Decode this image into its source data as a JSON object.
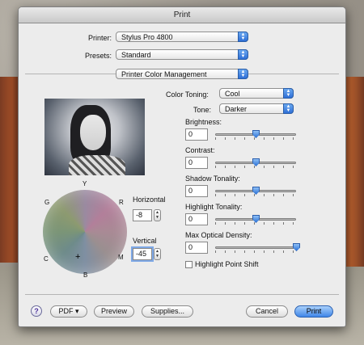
{
  "window": {
    "title": "Print"
  },
  "top": {
    "printer_label": "Printer:",
    "printer_value": "Stylus Pro 4800",
    "presets_label": "Presets:",
    "presets_value": "Standard",
    "panel_value": "Printer Color Management"
  },
  "toning": {
    "color_toning_label": "Color Toning:",
    "color_toning_value": "Cool",
    "tone_label": "Tone:",
    "tone_value": "Darker"
  },
  "wheel": {
    "letters": {
      "Y": "Y",
      "R": "R",
      "M": "M",
      "B": "B",
      "C": "C",
      "G": "G"
    },
    "crosshair": "+",
    "horizontal_label": "Horizontal",
    "horizontal_value": "-8",
    "vertical_label": "Vertical",
    "vertical_value": "-45"
  },
  "sliders": [
    {
      "label": "Brightness:",
      "value": "0",
      "level": 0.5
    },
    {
      "label": "Contrast:",
      "value": "0",
      "level": 0.5
    },
    {
      "label": "Shadow Tonality:",
      "value": "0",
      "level": 0.5
    },
    {
      "label": "Highlight Tonality:",
      "value": "0",
      "level": 0.5
    },
    {
      "label": "Max Optical Density:",
      "value": "0",
      "level": 1.0
    }
  ],
  "highlight_point_shift_label": "Highlight Point Shift",
  "bottom": {
    "help": "?",
    "pdf": "PDF ▾",
    "preview": "Preview",
    "supplies": "Supplies...",
    "cancel": "Cancel",
    "print": "Print"
  },
  "colors": {
    "accent": "#3f86e8",
    "window_bg": "#ececec"
  },
  "icons": {
    "popup_arrows": "updown-arrows-icon",
    "help": "help-icon",
    "photo": "preview-photo"
  }
}
